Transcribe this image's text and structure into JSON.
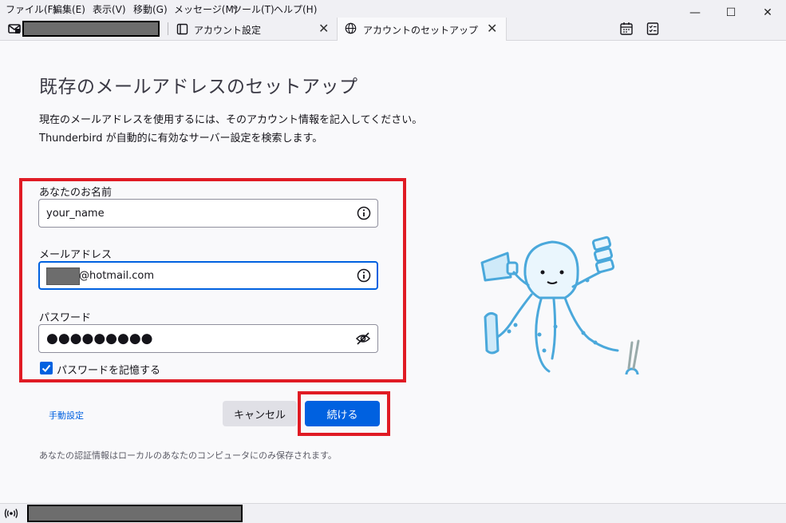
{
  "menu": {
    "items": [
      "ファイル(F)",
      "編集(E)",
      "表示(V)",
      "移動(G)",
      "メッセージ(M)",
      "ツール(T)",
      "ヘルプ(H)"
    ]
  },
  "window_controls": {
    "minimize": "—",
    "maximize": "☐",
    "close": "✕"
  },
  "tabs": {
    "tab2_label": "アカウント設定",
    "tab3_label": "アカウントのセットアップ",
    "close_glyph": "✕"
  },
  "setup": {
    "heading": "既存のメールアドレスのセットアップ",
    "desc_line1": "現在のメールアドレスを使用するには、そのアカウント情報を記入してください。",
    "desc_line2": "Thunderbird が自動的に有効なサーバー設定を検索します。",
    "name_label": "あなたのお名前",
    "name_value": "your_name",
    "email_label": "メールアドレス",
    "email_value": "@hotmail.com",
    "password_label": "パスワード",
    "password_value": "●●●●●●●●●",
    "remember_label": "パスワードを記憶する",
    "remember_checked": true,
    "manual_link": "手動設定",
    "cancel_label": "キャンセル",
    "continue_label": "続ける",
    "footnote": "あなたの認証情報はローカルのあなたのコンピュータにのみ保存されます。"
  },
  "colors": {
    "accent": "#0061e0",
    "highlight": "#e01b24",
    "mascot": "#5eb8e6"
  },
  "icons": [
    "mail-icon",
    "address-book-icon",
    "globe-icon",
    "calendar-icon",
    "tasks-icon",
    "info-icon",
    "eye-slash-icon",
    "checkmark-icon",
    "wifi-status-icon"
  ]
}
